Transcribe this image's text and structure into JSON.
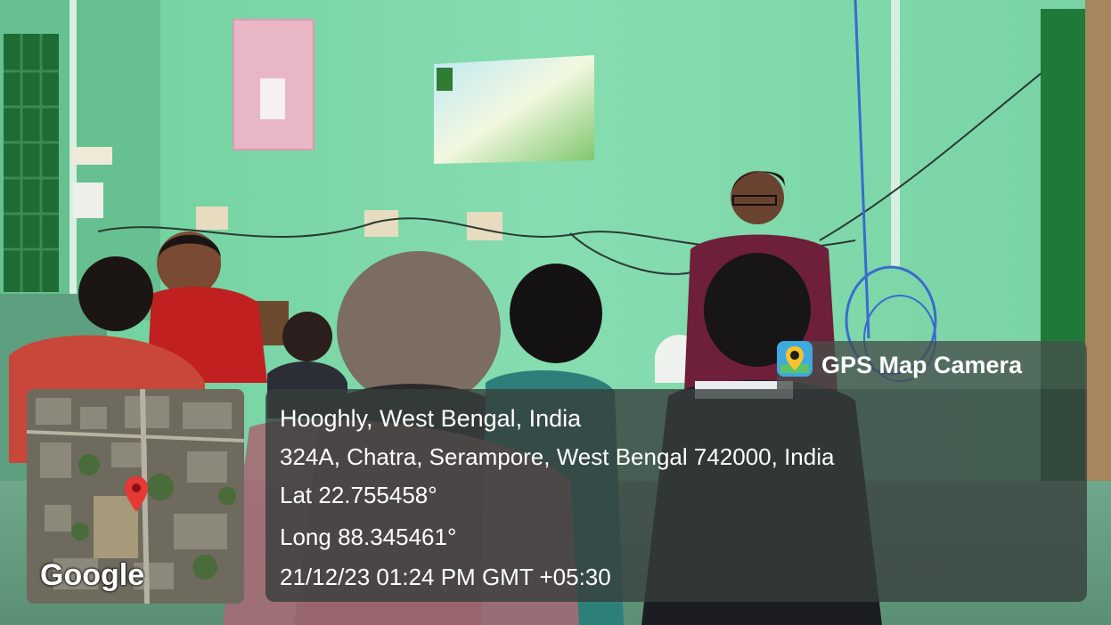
{
  "overlay": {
    "app_name": "GPS Map Camera",
    "location_title": "Hooghly, West Bengal, India",
    "address": "324A, Chatra, Serampore, West Bengal 742000, India",
    "latitude": "Lat 22.755458°",
    "longitude": "Long 88.345461°",
    "datetime": "21/12/23 01:24 PM GMT +05:30",
    "map_brand": "Google"
  },
  "colors": {
    "wall": "#7fd6a8",
    "door_frame": "#1f7a3a",
    "poster": "#eab8c8",
    "projection": "#e9f4c8",
    "presenter_top": "#6e1f3a",
    "overlay_bg": "#373e3c",
    "map_pin": "#e53935"
  },
  "icons": {
    "map_pin": "map-pin-icon",
    "app_logo": "gps-camera-logo-icon"
  }
}
